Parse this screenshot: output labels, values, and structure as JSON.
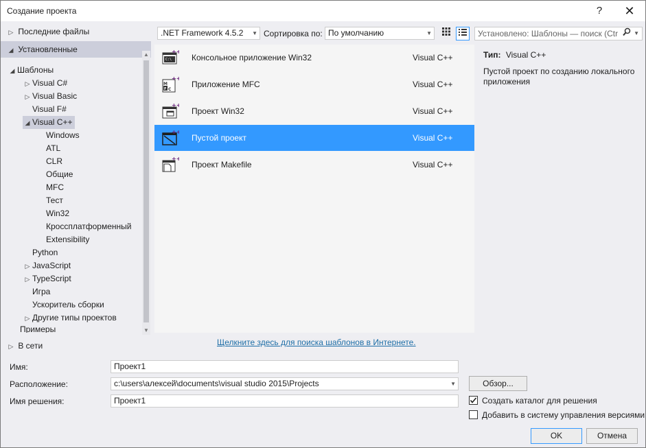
{
  "window": {
    "title": "Создание проекта",
    "help": "?",
    "close": "✕"
  },
  "tree": {
    "recent": "Последние файлы",
    "installed": "Установленные",
    "templates": "Шаблоны",
    "items": [
      {
        "label": "Visual C#",
        "expander": "▷"
      },
      {
        "label": "Visual Basic",
        "expander": "▷"
      },
      {
        "label": "Visual F#",
        "expander": ""
      },
      {
        "label": "Visual C++",
        "expander": "◢"
      }
    ],
    "cpp_children": [
      "Windows",
      "ATL",
      "CLR",
      "Общие",
      "MFC",
      "Тест",
      "Win32",
      "Кроссплатформенный",
      "Extensibility"
    ],
    "more_items": [
      {
        "label": "Python",
        "expander": ""
      },
      {
        "label": "JavaScript",
        "expander": "▷"
      },
      {
        "label": "TypeScript",
        "expander": "▷"
      },
      {
        "label": "Игра",
        "expander": ""
      },
      {
        "label": "Ускоритель сборки",
        "expander": ""
      },
      {
        "label": "Другие типы проектов",
        "expander": "▷"
      }
    ],
    "samples": "Примеры",
    "online": "В сети"
  },
  "toolbar": {
    "framework": ".NET Framework 4.5.2",
    "sort_label": "Сортировка по:",
    "sort_value": "По умолчанию",
    "search_placeholder": "Установлено: Шаблоны — поиск (Ctr"
  },
  "templates": [
    {
      "name": "Консольное приложение Win32",
      "lang": "Visual C++",
      "icon": "console-app-icon"
    },
    {
      "name": "Приложение MFC",
      "lang": "Visual C++",
      "icon": "mfc-app-icon"
    },
    {
      "name": "Проект Win32",
      "lang": "Visual C++",
      "icon": "win32-project-icon"
    },
    {
      "name": "Пустой проект",
      "lang": "Visual C++",
      "icon": "empty-project-icon"
    },
    {
      "name": "Проект Makefile",
      "lang": "Visual C++",
      "icon": "makefile-project-icon"
    }
  ],
  "online_link": "Щелкните здесь для поиска шаблонов в Интернете.",
  "description": {
    "type_label": "Тип:",
    "type_value": "Visual C++",
    "text": "Пустой проект по созданию локального приложения"
  },
  "form": {
    "name_label": "Имя:",
    "name_value": "Проект1",
    "location_label": "Расположение:",
    "location_value": "c:\\users\\алексей\\documents\\visual studio 2015\\Projects",
    "browse": "Обзор...",
    "solution_label": "Имя решения:",
    "solution_value": "Проект1",
    "create_dir": "Создать каталог для решения",
    "add_vcs": "Добавить в систему управления версиями",
    "ok": "OK",
    "cancel": "Отмена"
  },
  "colors": {
    "accent": "#3399ff",
    "selected_section": "#cccedb",
    "link": "#1e6ea7"
  }
}
